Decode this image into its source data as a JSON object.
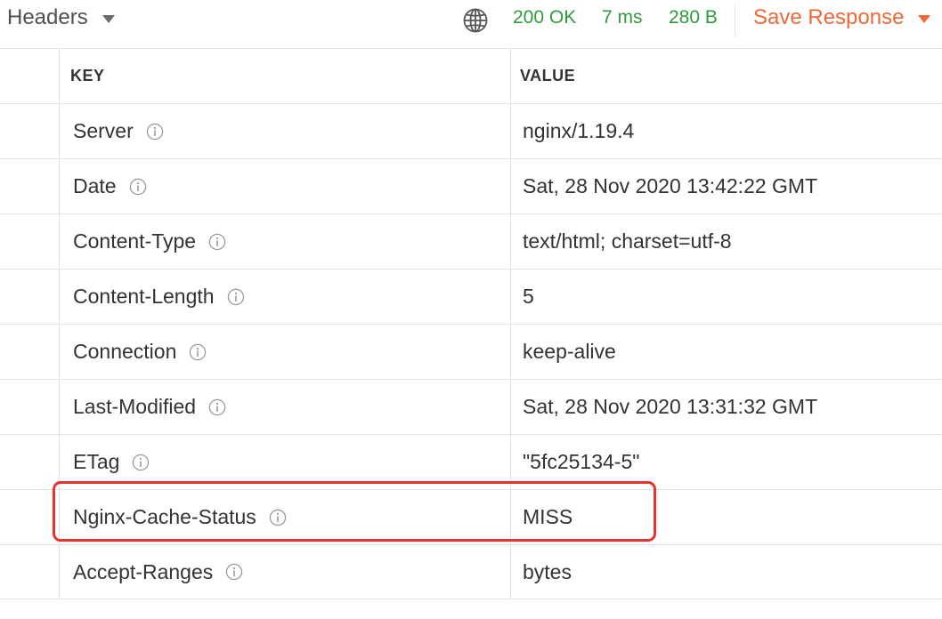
{
  "toolbar": {
    "tab_label": "Headers",
    "status": "200 OK",
    "time": "7 ms",
    "size": "280 B",
    "save_label": "Save Response",
    "status_color": "#2f9a3c",
    "accent_color": "#f0683a"
  },
  "table": {
    "columns": {
      "key": "KEY",
      "value": "VALUE"
    },
    "rows": [
      {
        "key": "Server",
        "value": "nginx/1.19.4"
      },
      {
        "key": "Date",
        "value": "Sat, 28 Nov 2020 13:42:22 GMT"
      },
      {
        "key": "Content-Type",
        "value": "text/html; charset=utf-8"
      },
      {
        "key": "Content-Length",
        "value": "5"
      },
      {
        "key": "Connection",
        "value": "keep-alive"
      },
      {
        "key": "Last-Modified",
        "value": "Sat, 28 Nov 2020 13:31:32 GMT"
      },
      {
        "key": "ETag",
        "value": "\"5fc25134-5\""
      },
      {
        "key": "Nginx-Cache-Status",
        "value": "MISS"
      },
      {
        "key": "Accept-Ranges",
        "value": "bytes"
      }
    ]
  },
  "icons": {
    "globe": "globe-icon",
    "info": "info-icon",
    "caret": "chevron-down-icon"
  }
}
